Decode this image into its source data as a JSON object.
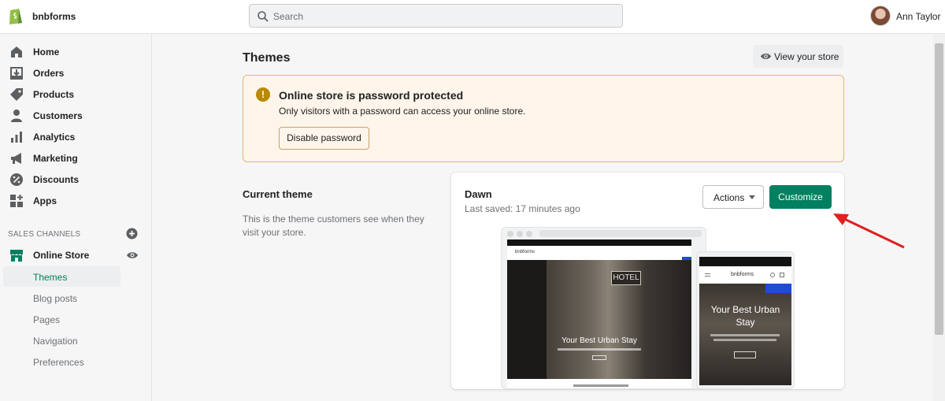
{
  "topbar": {
    "store_name": "bnbforms",
    "search_placeholder": "Search",
    "user_name": "Ann Taylor"
  },
  "sidebar": {
    "items": [
      {
        "label": "Home",
        "icon": "home-icon"
      },
      {
        "label": "Orders",
        "icon": "orders-icon"
      },
      {
        "label": "Products",
        "icon": "tag-icon"
      },
      {
        "label": "Customers",
        "icon": "person-icon"
      },
      {
        "label": "Analytics",
        "icon": "bar-chart-icon"
      },
      {
        "label": "Marketing",
        "icon": "megaphone-icon"
      },
      {
        "label": "Discounts",
        "icon": "discount-icon"
      },
      {
        "label": "Apps",
        "icon": "apps-icon"
      }
    ],
    "sales_channels_heading": "SALES CHANNELS",
    "online_store_label": "Online Store",
    "sub_items": [
      "Themes",
      "Blog posts",
      "Pages",
      "Navigation",
      "Preferences"
    ]
  },
  "main": {
    "title": "Themes",
    "view_store_label": "View your store",
    "banner": {
      "title": "Online store is password protected",
      "description": "Only visitors with a password can access your online store.",
      "button_label": "Disable password"
    },
    "current_theme": {
      "heading": "Current theme",
      "description": "This is the theme customers see when they visit your store."
    },
    "theme_card": {
      "name": "Dawn",
      "last_saved": "Last saved: 17 minutes ago",
      "actions_label": "Actions",
      "customize_label": "Customize",
      "preview": {
        "desktop_brand": "bnbforms",
        "desktop_sign": "HOTEL",
        "desktop_headline": "Your Best Urban Stay",
        "mobile_brand": "bnbforms",
        "mobile_headline": "Your Best Urban Stay"
      }
    }
  },
  "colors": {
    "accent": "#008060",
    "banner_bg": "#fff5ea",
    "warning": "#b98900",
    "annotation_arrow": "#e02020"
  }
}
